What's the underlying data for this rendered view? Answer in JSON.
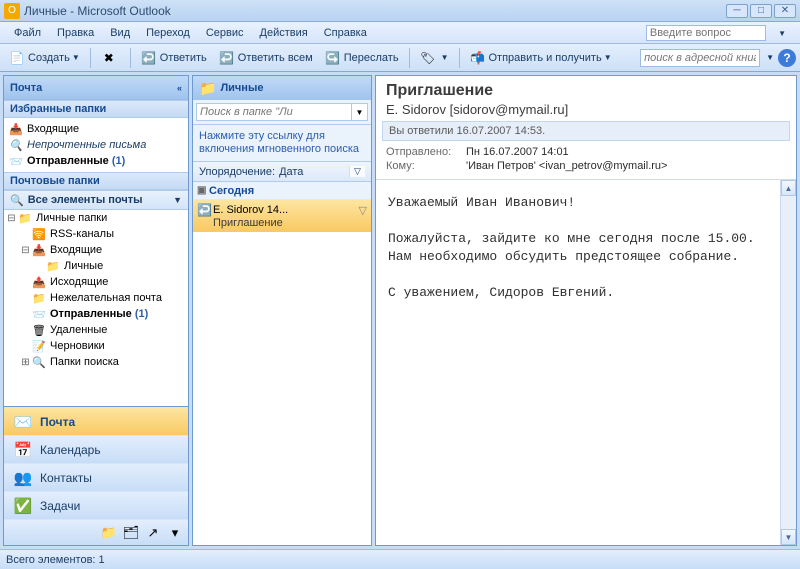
{
  "window": {
    "title": "Личные - Microsoft Outlook"
  },
  "menu": {
    "items": [
      "Файл",
      "Правка",
      "Вид",
      "Переход",
      "Сервис",
      "Действия",
      "Справка"
    ],
    "ask_placeholder": "Введите вопрос"
  },
  "toolbar": {
    "new": "Создать",
    "reply": "Ответить",
    "reply_all": "Ответить всем",
    "forward": "Переслать",
    "send_recv": "Отправить и получить",
    "addr_search_placeholder": "поиск в адресной книге"
  },
  "nav": {
    "header": "Почта",
    "fav_header": "Избранные папки",
    "fav_items": [
      {
        "label": "Входящие",
        "icon": "📥"
      },
      {
        "label": "Непрочтенные письма",
        "icon": "🔍",
        "italic": true
      },
      {
        "label": "Отправленные",
        "icon": "📨",
        "bold": true,
        "count": "(1)"
      }
    ],
    "mail_header": "Почтовые папки",
    "filter": "Все элементы почты",
    "tree": [
      {
        "ind": 0,
        "toggle": "-",
        "icon": "📁",
        "label": "Личные папки"
      },
      {
        "ind": 1,
        "toggle": "",
        "icon": "🛜",
        "label": "RSS-каналы"
      },
      {
        "ind": 1,
        "toggle": "-",
        "icon": "📥",
        "label": "Входящие"
      },
      {
        "ind": 2,
        "toggle": "",
        "icon": "📁",
        "label": "Личные"
      },
      {
        "ind": 1,
        "toggle": "",
        "icon": "📤",
        "label": "Исходящие"
      },
      {
        "ind": 1,
        "toggle": "",
        "icon": "📁",
        "label": "Нежелательная почта"
      },
      {
        "ind": 1,
        "toggle": "",
        "icon": "📨",
        "label": "Отправленные",
        "bold": true,
        "count": "(1)"
      },
      {
        "ind": 1,
        "toggle": "",
        "icon": "🗑",
        "label": "Удаленные"
      },
      {
        "ind": 1,
        "toggle": "",
        "icon": "📝",
        "label": "Черновики"
      },
      {
        "ind": 1,
        "toggle": "+",
        "icon": "🔍",
        "label": "Папки поиска"
      }
    ],
    "sections": [
      {
        "icon": "✉️",
        "label": "Почта",
        "selected": true
      },
      {
        "icon": "📅",
        "label": "Календарь"
      },
      {
        "icon": "👥",
        "label": "Контакты"
      },
      {
        "icon": "✅",
        "label": "Задачи"
      }
    ],
    "mini": [
      "📁",
      "🗂",
      "↗",
      "▾"
    ]
  },
  "list": {
    "header": "Личные",
    "search_placeholder": "Поиск в папке \"Ли",
    "hint": "Нажмите эту ссылку для включения мгновенного поиска",
    "sort_label": "Упорядочение:",
    "sort_value": "Дата",
    "group": "Сегодня",
    "messages": [
      {
        "from": "E. Sidorov 14...",
        "subject": "Приглашение",
        "selected": true
      }
    ]
  },
  "read": {
    "subject": "Приглашение",
    "from": "E. Sidorov [sidorov@mymail.ru]",
    "info": "Вы ответили 16.07.2007 14:53.",
    "sent_label": "Отправлено:",
    "sent_value": "Пн 16.07.2007 14:01",
    "to_label": "Кому:",
    "to_value": "'Иван Петров' <ivan_petrov@mymail.ru>",
    "body_lines": [
      "Уважаемый Иван Иванович!",
      "",
      "Пожалуйста, зайдите ко мне сегодня после 15.00.",
      "Нам необходимо обсудить предстоящее собрание.",
      "",
      "С уважением, Сидоров Евгений."
    ]
  },
  "status": {
    "text": "Всего элементов: 1"
  }
}
